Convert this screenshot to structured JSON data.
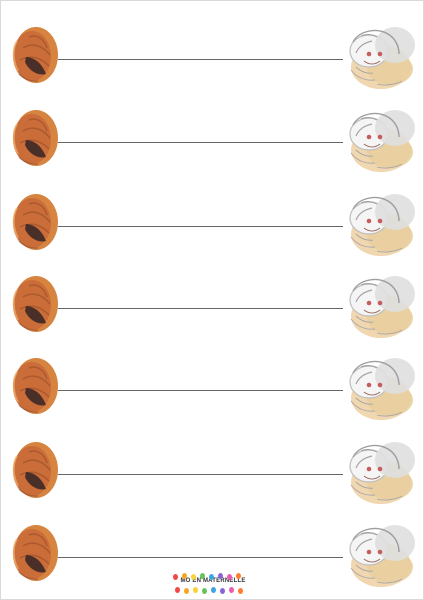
{
  "worksheet": {
    "rows": [
      {
        "left_icon": "bread-loaf-icon",
        "right_icon": "grandmother-icon"
      },
      {
        "left_icon": "bread-loaf-icon",
        "right_icon": "grandmother-icon"
      },
      {
        "left_icon": "bread-loaf-icon",
        "right_icon": "grandmother-icon"
      },
      {
        "left_icon": "bread-loaf-icon",
        "right_icon": "grandmother-icon"
      },
      {
        "left_icon": "bread-loaf-icon",
        "right_icon": "grandmother-icon"
      },
      {
        "left_icon": "bread-loaf-icon",
        "right_icon": "grandmother-icon"
      },
      {
        "left_icon": "bread-loaf-icon",
        "right_icon": "grandmother-icon"
      }
    ]
  },
  "footer": {
    "logo_text": "MO EN MATERNELLE",
    "logo_colors": [
      "#f04848",
      "#f6a623",
      "#f5d33a",
      "#66c25a",
      "#3aa7e2",
      "#8a64d6",
      "#e85bb0",
      "#ff7d2f"
    ]
  }
}
